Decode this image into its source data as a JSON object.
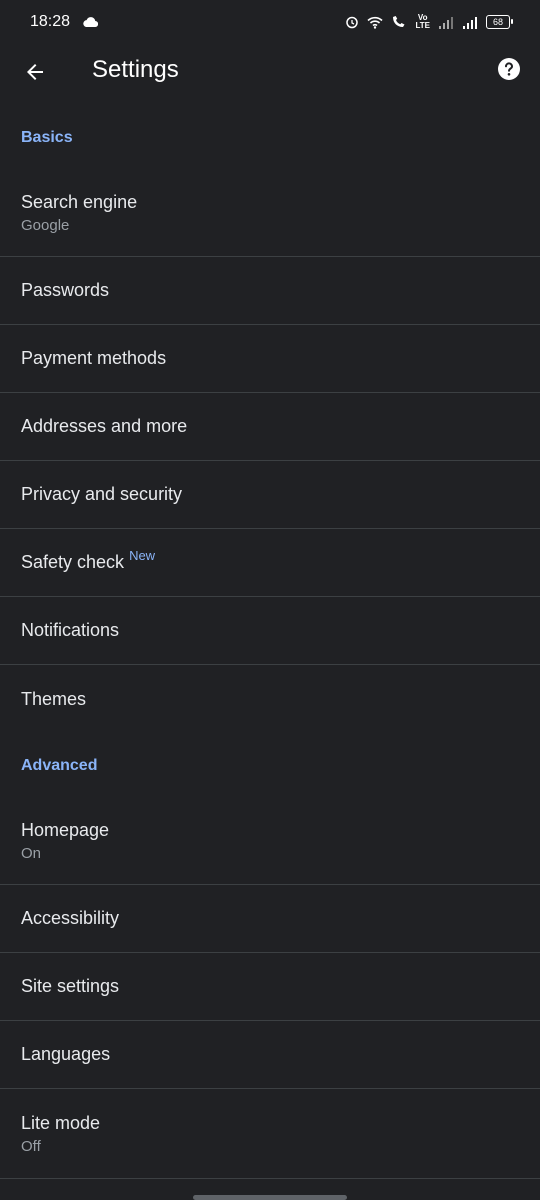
{
  "status_bar": {
    "time": "18:28",
    "volte_label": "Vo\nLTE",
    "battery": "68",
    "icons": [
      "cloud-icon",
      "alarm-icon",
      "wifi-icon",
      "wifi-call-icon",
      "volte-icon",
      "signal-icon",
      "signal-icon",
      "battery-icon"
    ]
  },
  "toolbar": {
    "title": "Settings",
    "back_icon": "back-arrow-icon",
    "help_icon": "help-icon"
  },
  "sections": {
    "basics": "Basics",
    "advanced": "Advanced"
  },
  "items": {
    "search_engine": {
      "label": "Search engine",
      "sub": "Google"
    },
    "passwords": {
      "label": "Passwords"
    },
    "payment_methods": {
      "label": "Payment methods"
    },
    "addresses": {
      "label": "Addresses and more"
    },
    "privacy": {
      "label": "Privacy and security"
    },
    "safety_check": {
      "label": "Safety check",
      "badge": "New"
    },
    "notifications": {
      "label": "Notifications"
    },
    "themes": {
      "label": "Themes"
    },
    "homepage": {
      "label": "Homepage",
      "sub": "On"
    },
    "accessibility": {
      "label": "Accessibility"
    },
    "site_settings": {
      "label": "Site settings"
    },
    "languages": {
      "label": "Languages"
    },
    "lite_mode": {
      "label": "Lite mode",
      "sub": "Off"
    }
  },
  "colors": {
    "background": "#202124",
    "accent": "#8ab4f8",
    "text_primary": "#e8eaed",
    "text_secondary": "#9aa0a6",
    "divider": "#3c4043"
  }
}
